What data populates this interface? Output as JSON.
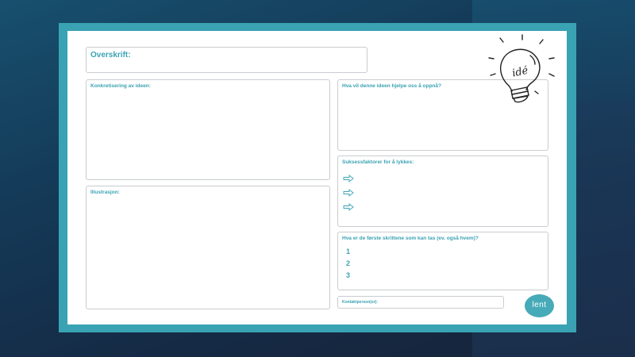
{
  "worksheet": {
    "title_label": "Overskrift:",
    "concretization_label": "Konkretisering av ideen:",
    "goal_label": "Hva vil denne ideen hjelpe oss å oppnå?",
    "success_label": "Suksessfaktorer for å lykkes:",
    "success_items": [
      "arrow-right-icon",
      "arrow-right-icon",
      "arrow-right-icon"
    ],
    "illustration_label": "Illustrasjon:",
    "steps_label": "Hva er de første skrittene som kan tas (ev. også hvem)?",
    "step_numbers": [
      "1",
      "2",
      "3"
    ],
    "contact_label": "Kontaktperson(er):",
    "bulb_text": "idé",
    "logo_text": "lent"
  },
  "colors": {
    "accent": "#3aa3b3",
    "frame": "#3aa3b3",
    "logo": "#47aab8",
    "background": "#17304d"
  }
}
